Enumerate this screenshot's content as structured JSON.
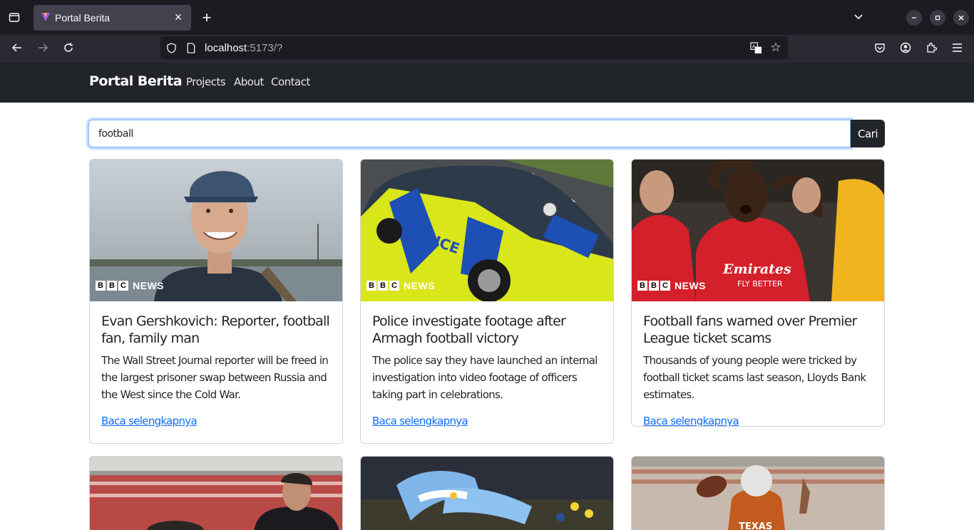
{
  "browser": {
    "tab_title": "Portal Berita",
    "url_host": "localhost",
    "url_rest": ":5173/?"
  },
  "site": {
    "brand": "Portal Berita",
    "nav": [
      "Projects",
      "About",
      "Contact"
    ]
  },
  "search": {
    "value": "football",
    "button_label": "Cari"
  },
  "bbc_badge": {
    "letters": [
      "B",
      "B",
      "C"
    ],
    "word": "NEWS"
  },
  "articles": [
    {
      "title": "Evan Gershkovich: Reporter, football fan, family man",
      "description": "The Wall Street Journal reporter will be freed in the largest prisoner swap between Russia and the West since the Cold War.",
      "link": "Baca selengkapnya"
    },
    {
      "title": "Police investigate footage after Armagh football victory",
      "description": "The police say they have launched an internal investigation into video footage of officers taking part in celebrations.",
      "link": "Baca selengkapnya"
    },
    {
      "title": "Football fans warned over Premier League ticket scams",
      "description": "Thousands of young people were tricked by football ticket scams last season, Lloyds Bank estimates.",
      "link": "Baca selengkapnya"
    }
  ],
  "colors": {
    "navbar": "#212529",
    "link": "#0d6efd",
    "browser_bg": "#1c1b22"
  }
}
